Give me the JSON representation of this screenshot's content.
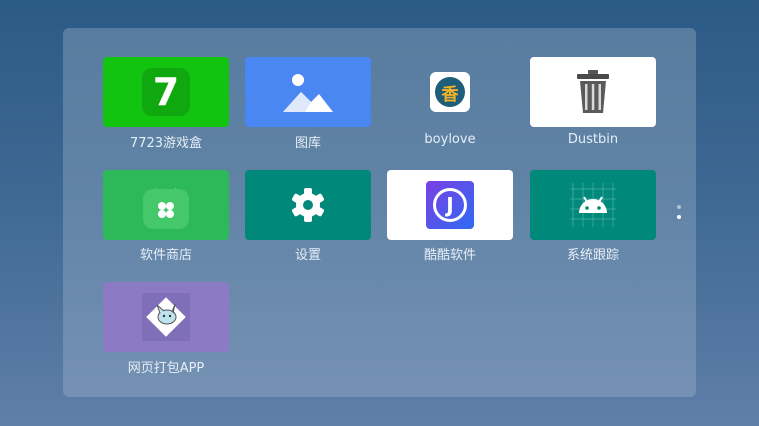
{
  "apps": [
    {
      "label": "7723游戏盒",
      "icon": "7723-game-box-icon",
      "bg": "#12c410"
    },
    {
      "label": "图库",
      "icon": "gallery-icon",
      "bg": "#4a87f2"
    },
    {
      "label": "boylove",
      "icon": "boylove-icon",
      "bg": "transparent"
    },
    {
      "label": "Dustbin",
      "icon": "trash-icon",
      "bg": "#ffffff"
    },
    {
      "label": "软件商店",
      "icon": "app-store-icon",
      "bg": "#2db85a"
    },
    {
      "label": "设置",
      "icon": "gear-icon",
      "bg": "#00897b"
    },
    {
      "label": "酷酷软件",
      "icon": "kuku-software-icon",
      "bg": "#ffffff"
    },
    {
      "label": "系统跟踪",
      "icon": "android-icon",
      "bg": "#00897b"
    },
    {
      "label": "网页打包APP",
      "icon": "web-package-app-icon",
      "bg": "#8c7ac4"
    }
  ],
  "boylove_badge": "香",
  "kuku_letter": "J",
  "seven_glyph": "7"
}
